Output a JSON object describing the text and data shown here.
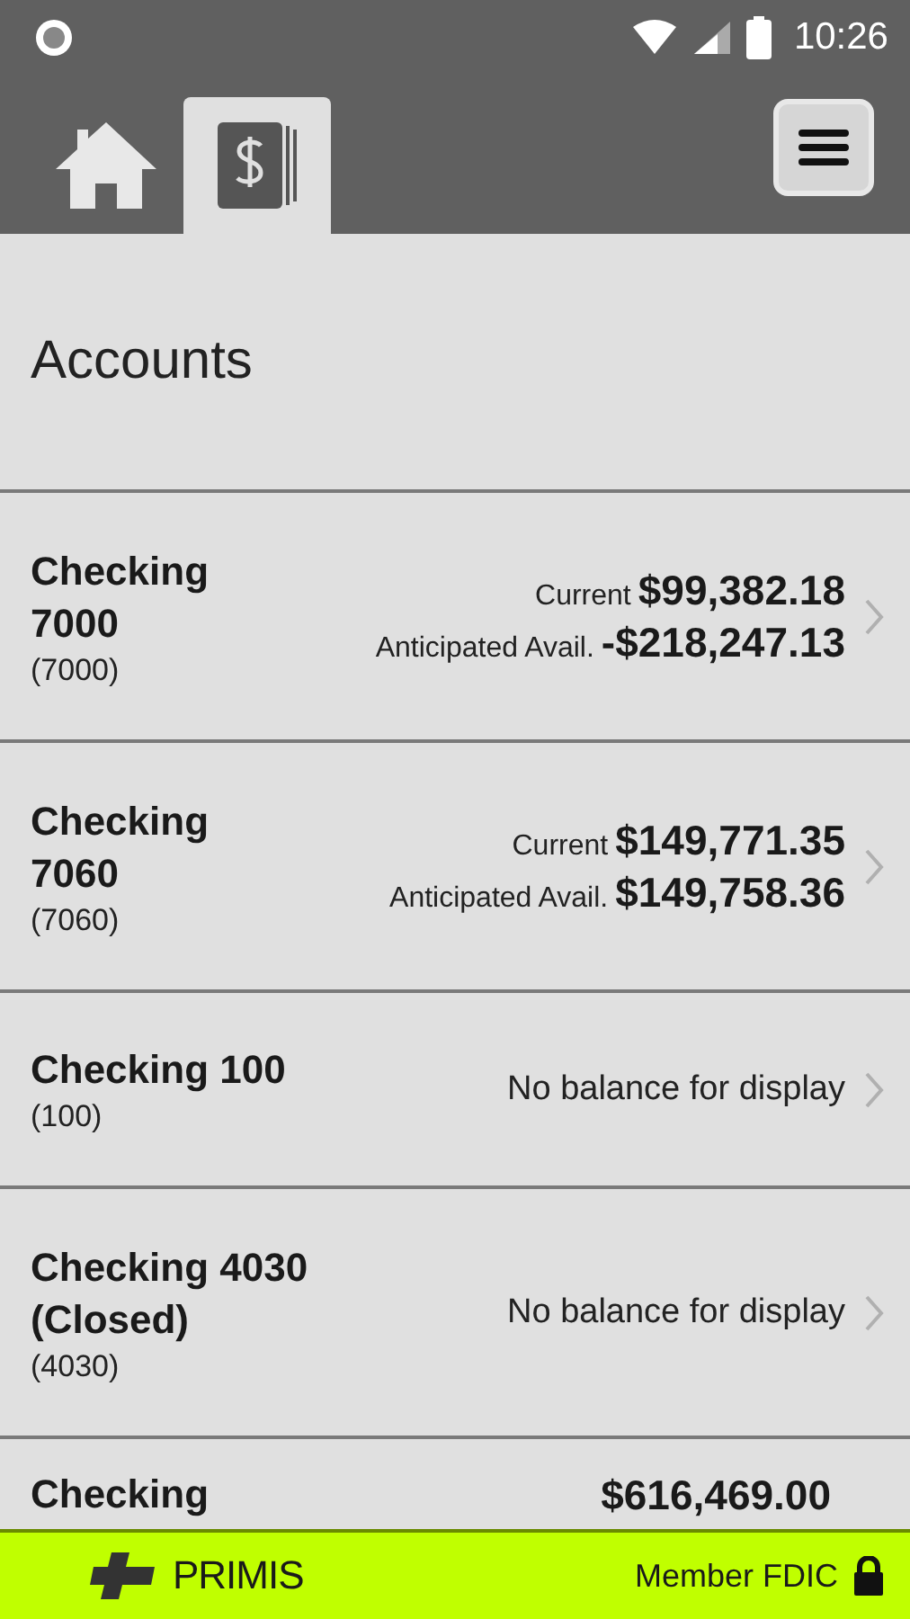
{
  "status_bar": {
    "time": "10:26"
  },
  "tabs": [
    {
      "kind": "home",
      "selected": false
    },
    {
      "kind": "accounts",
      "selected": true
    }
  ],
  "page_title": "Accounts",
  "accounts": [
    {
      "kind": "balances",
      "name": "Checking 7000",
      "number": "(7000)",
      "current_label": "Current",
      "current": "$99,382.18",
      "anticipated_label": "Anticipated Avail.",
      "anticipated": "-$218,247.13"
    },
    {
      "kind": "balances",
      "name": "Checking 7060",
      "number": "(7060)",
      "current_label": "Current",
      "current": "$149,771.35",
      "anticipated_label": "Anticipated Avail.",
      "anticipated": "$149,758.36"
    },
    {
      "kind": "none",
      "name": "Checking 100",
      "number": "(100)",
      "message": "No balance for display"
    },
    {
      "kind": "none",
      "name": "Checking 4030 (Closed)",
      "number": "(4030)",
      "message": "No balance for display"
    },
    {
      "kind": "partial",
      "name": "Checking",
      "current": "$616,469.00"
    }
  ],
  "footer": {
    "brand": "PRIMIS",
    "member": "Member FDIC"
  }
}
